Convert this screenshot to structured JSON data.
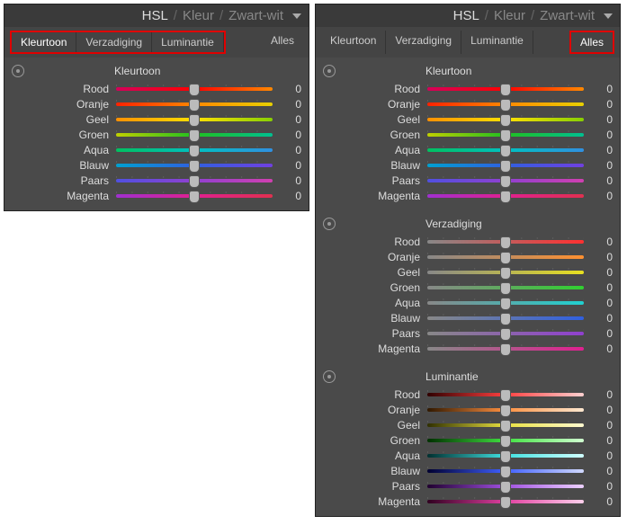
{
  "header": {
    "hsl": "HSL",
    "kleur": "Kleur",
    "zwartwit": "Zwart-wit"
  },
  "tabs": {
    "kleurtoon": "Kleurtoon",
    "verzadiging": "Verzadiging",
    "luminantie": "Luminantie",
    "alles": "Alles"
  },
  "sections": {
    "kleurtoon": "Kleurtoon",
    "verzadiging": "Verzadiging",
    "luminantie": "Luminantie"
  },
  "colors": {
    "rood": "Rood",
    "oranje": "Oranje",
    "geel": "Geel",
    "groen": "Groen",
    "aqua": "Aqua",
    "blauw": "Blauw",
    "paars": "Paars",
    "magenta": "Magenta"
  },
  "values": {
    "left": {
      "kleurtoon": {
        "rood": 0,
        "oranje": 0,
        "geel": 0,
        "groen": 0,
        "aqua": 0,
        "blauw": 0,
        "paars": 0,
        "magenta": 0
      }
    },
    "right": {
      "kleurtoon": {
        "rood": 0,
        "oranje": 0,
        "geel": 0,
        "groen": 0,
        "aqua": 0,
        "blauw": 0,
        "paars": 0,
        "magenta": 0
      },
      "verzadiging": {
        "rood": 0,
        "oranje": 0,
        "geel": 0,
        "groen": 0,
        "aqua": 0,
        "blauw": 0,
        "paars": 0,
        "magenta": 0
      },
      "luminantie": {
        "rood": 0,
        "oranje": 0,
        "geel": 0,
        "groen": 0,
        "aqua": 0,
        "blauw": 0,
        "paars": 0,
        "magenta": 0
      }
    }
  }
}
